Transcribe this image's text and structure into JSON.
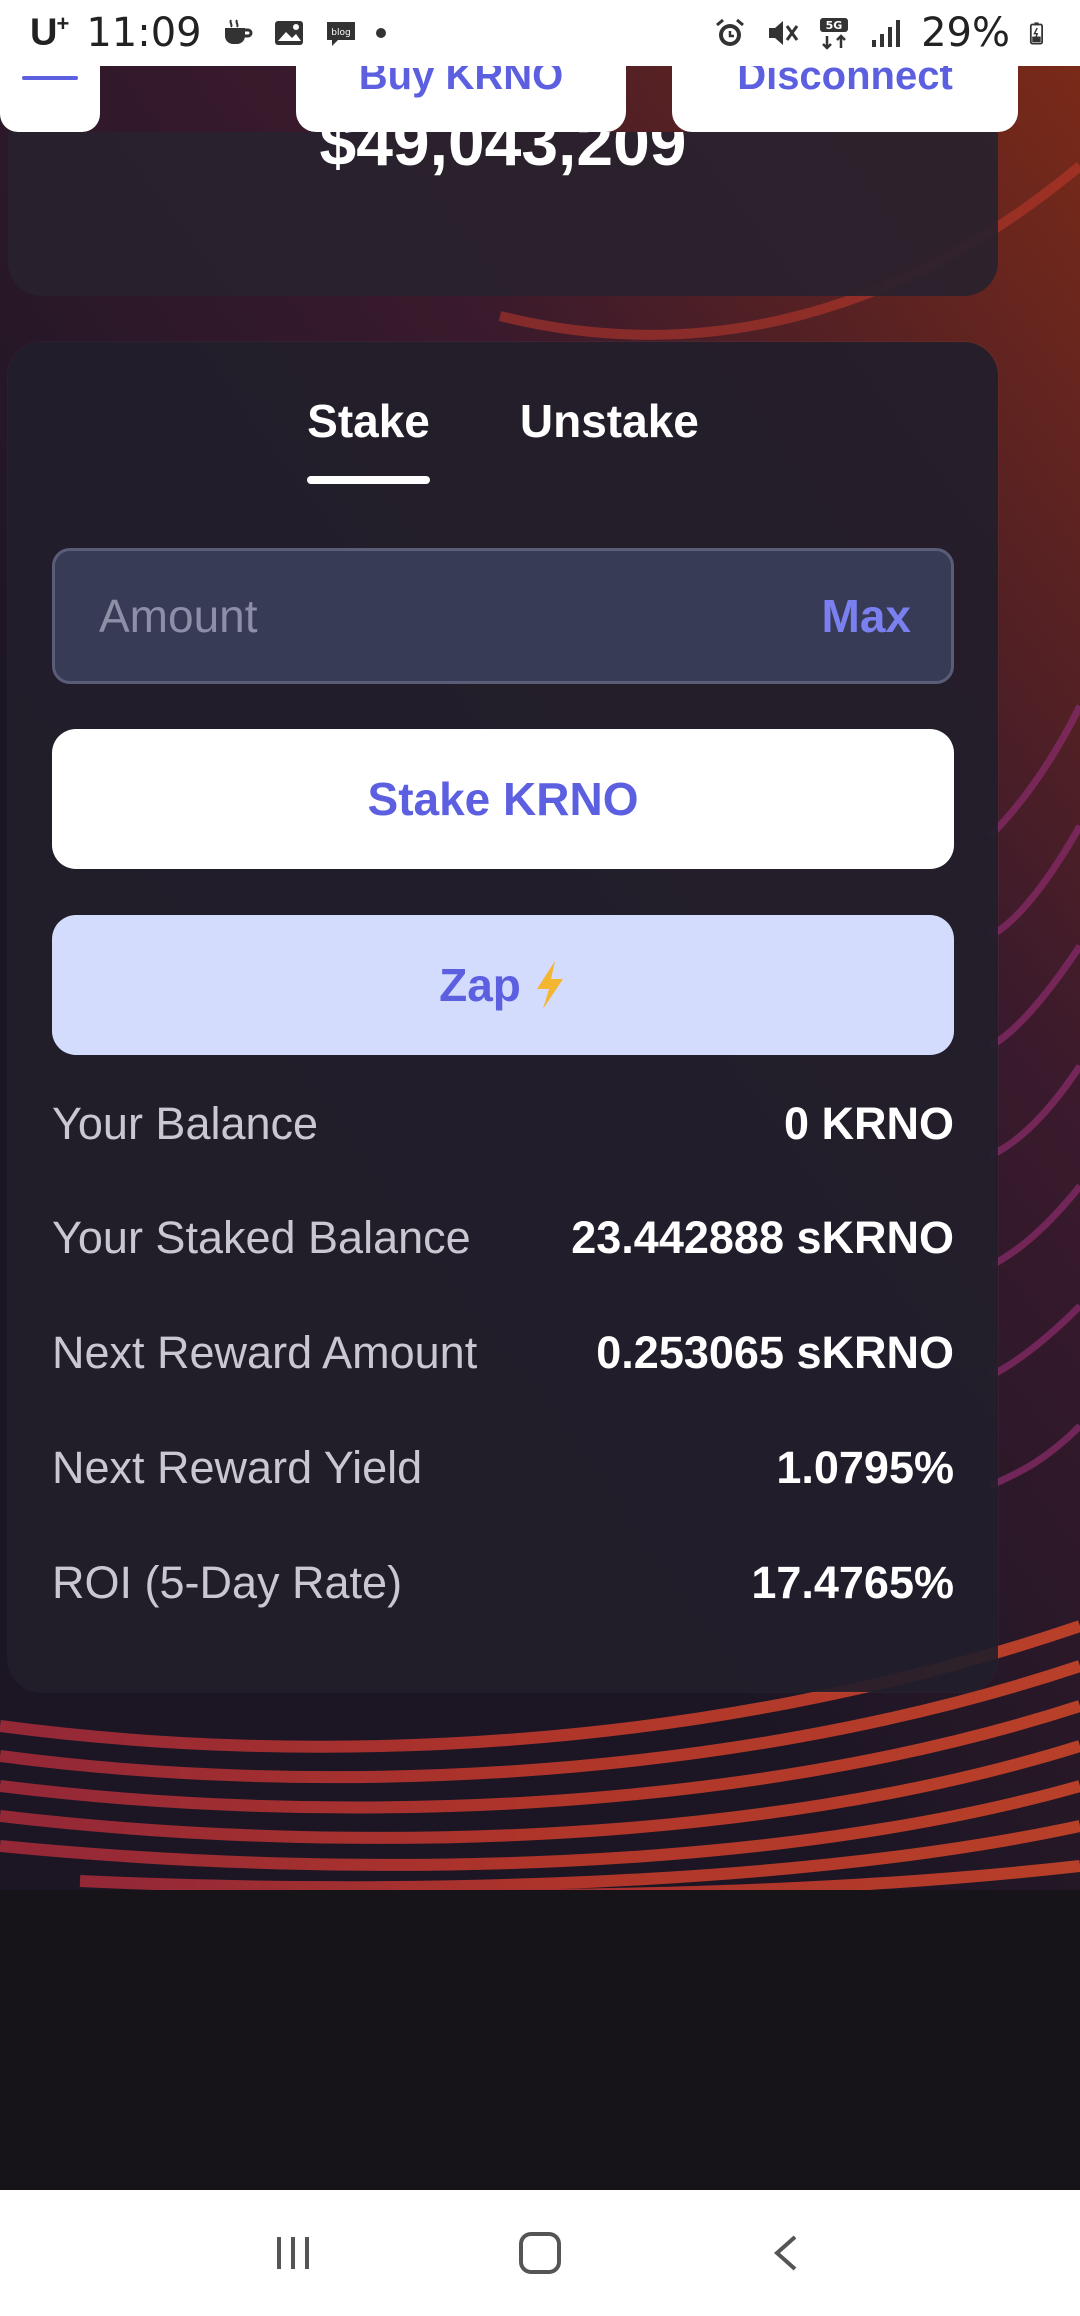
{
  "status_bar": {
    "carrier": "U",
    "carrier_sup": "+",
    "time": "11:09",
    "battery": "29%",
    "icons": [
      "coffee-icon",
      "image-icon",
      "blog-icon",
      "dot-icon",
      "alarm-icon",
      "mute-icon",
      "5g-icon",
      "signal-icon",
      "battery-icon"
    ]
  },
  "nav": {
    "menu_icon": "hamburger-icon",
    "buy_label": "Buy KRNO",
    "disconnect_label": "Disconnect"
  },
  "tvl": {
    "value": "$49,043,209"
  },
  "tabs": [
    {
      "label": "Stake",
      "active": true
    },
    {
      "label": "Unstake",
      "active": false
    }
  ],
  "amount": {
    "placeholder": "Amount",
    "value": "",
    "max_label": "Max"
  },
  "buttons": {
    "stake_label": "Stake KRNO",
    "zap_label": "Zap",
    "zap_icon": "lightning-icon"
  },
  "info": [
    {
      "label": "Your Balance",
      "value": "0 KRNO"
    },
    {
      "label": "Your Staked Balance",
      "value": "23.442888 sKRNO"
    },
    {
      "label": "Next Reward Amount",
      "value": "0.253065 sKRNO"
    },
    {
      "label": "Next Reward Yield",
      "value": "1.0795%"
    },
    {
      "label": "ROI (5-Day Rate)",
      "value": "17.4765%"
    }
  ],
  "system_nav": {
    "icons": [
      "recent-apps-icon",
      "home-icon",
      "back-icon"
    ]
  },
  "colors": {
    "accent": "#5b5fe0",
    "card_bg": "#221e2a",
    "input_bg": "#373b56",
    "zap_bg": "#d3dcfd"
  }
}
